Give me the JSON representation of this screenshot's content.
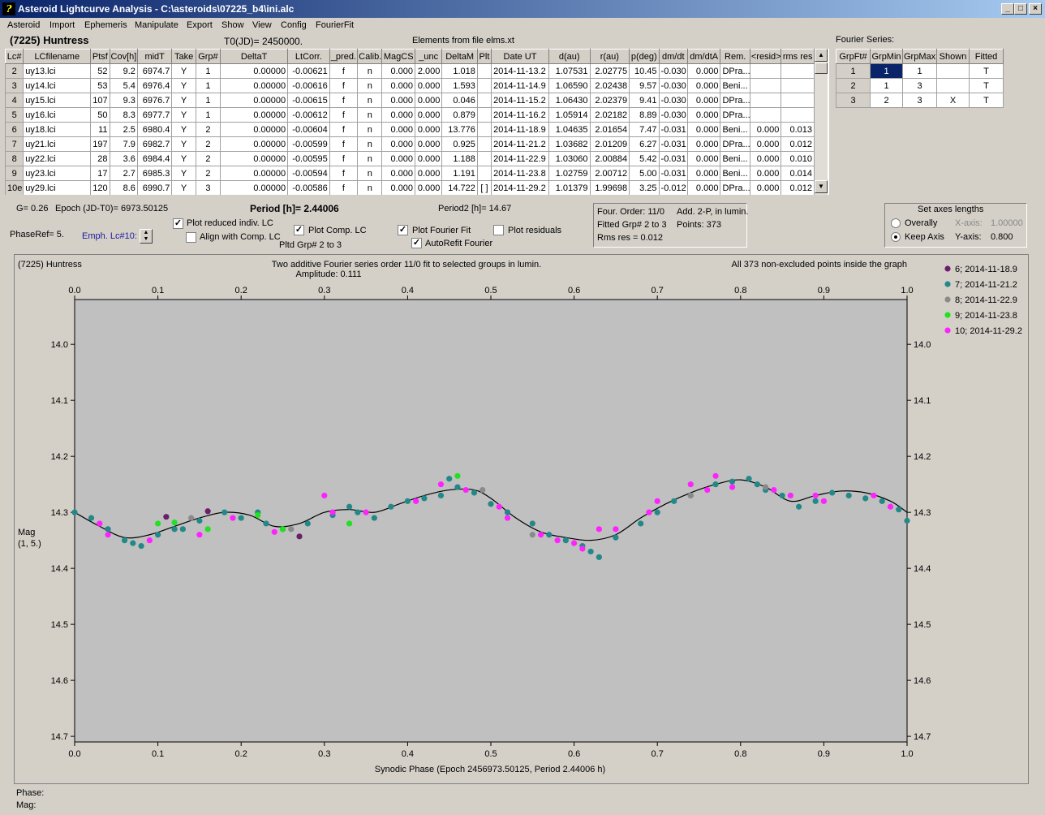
{
  "window": {
    "title": "Asteroid Lightcurve Analysis - C:\\asteroids\\07225_b4\\ini.alc",
    "min": "_",
    "max": "□",
    "close": "×"
  },
  "menu": [
    "Asteroid",
    "Import",
    "Ephemeris",
    "Manipulate",
    "Export",
    "Show",
    "View",
    "Config",
    "FourierFit"
  ],
  "header": {
    "asteroid": "(7225) Huntress",
    "t0": "T0(JD)= 2450000.",
    "elements": "Elements from file elms.xt"
  },
  "table": {
    "columns": [
      "Lc#",
      "LCfilename",
      "Ptsf",
      "Cov[h]",
      "midT",
      "Take",
      "Grp#",
      "DeltaT",
      "LtCorr.",
      "_pred.",
      "Calib.",
      "MagCS",
      "_unc",
      "DeltaM",
      "Plt",
      "Date UT",
      "d(au)",
      "r(au)",
      "p(deg)",
      "dm/dt",
      "dm/dtA",
      "Rem.",
      "<resid>",
      "rms res"
    ],
    "rows": [
      [
        "2",
        "uy13.lci",
        "52",
        "9.2",
        "6974.7",
        "Y",
        "1",
        "0.00000",
        "-0.00621",
        "f",
        "n",
        "0.000",
        "2.000",
        "1.018",
        "",
        "2014-11-13.2",
        "1.07531",
        "2.02775",
        "10.45",
        "-0.030",
        "0.000",
        "DPra...",
        "",
        ""
      ],
      [
        "3",
        "uy14.lci",
        "53",
        "5.4",
        "6976.4",
        "Y",
        "1",
        "0.00000",
        "-0.00616",
        "f",
        "n",
        "0.000",
        "0.000",
        "1.593",
        "",
        "2014-11-14.9",
        "1.06590",
        "2.02438",
        "9.57",
        "-0.030",
        "0.000",
        "Beni...",
        "",
        ""
      ],
      [
        "4",
        "uy15.lci",
        "107",
        "9.3",
        "6976.7",
        "Y",
        "1",
        "0.00000",
        "-0.00615",
        "f",
        "n",
        "0.000",
        "0.000",
        "0.046",
        "",
        "2014-11-15.2",
        "1.06430",
        "2.02379",
        "9.41",
        "-0.030",
        "0.000",
        "DPra...",
        "",
        ""
      ],
      [
        "5",
        "uy16.lci",
        "50",
        "8.3",
        "6977.7",
        "Y",
        "1",
        "0.00000",
        "-0.00612",
        "f",
        "n",
        "0.000",
        "0.000",
        "0.879",
        "",
        "2014-11-16.2",
        "1.05914",
        "2.02182",
        "8.89",
        "-0.030",
        "0.000",
        "DPra...",
        "",
        ""
      ],
      [
        "6",
        "uy18.lci",
        "11",
        "2.5",
        "6980.4",
        "Y",
        "2",
        "0.00000",
        "-0.00604",
        "f",
        "n",
        "0.000",
        "0.000",
        "13.776",
        "",
        "2014-11-18.9",
        "1.04635",
        "2.01654",
        "7.47",
        "-0.031",
        "0.000",
        "Beni...",
        "0.000",
        "0.013"
      ],
      [
        "7",
        "uy21.lci",
        "197",
        "7.9",
        "6982.7",
        "Y",
        "2",
        "0.00000",
        "-0.00599",
        "f",
        "n",
        "0.000",
        "0.000",
        "0.925",
        "",
        "2014-11-21.2",
        "1.03682",
        "2.01209",
        "6.27",
        "-0.031",
        "0.000",
        "DPra...",
        "0.000",
        "0.012"
      ],
      [
        "8",
        "uy22.lci",
        "28",
        "3.6",
        "6984.4",
        "Y",
        "2",
        "0.00000",
        "-0.00595",
        "f",
        "n",
        "0.000",
        "0.000",
        "1.188",
        "",
        "2014-11-22.9",
        "1.03060",
        "2.00884",
        "5.42",
        "-0.031",
        "0.000",
        "Beni...",
        "0.000",
        "0.010"
      ],
      [
        "9",
        "uy23.lci",
        "17",
        "2.7",
        "6985.3",
        "Y",
        "2",
        "0.00000",
        "-0.00594",
        "f",
        "n",
        "0.000",
        "0.000",
        "1.191",
        "",
        "2014-11-23.8",
        "1.02759",
        "2.00712",
        "5.00",
        "-0.031",
        "0.000",
        "Beni...",
        "0.000",
        "0.014"
      ],
      [
        "10e",
        "uy29.lci",
        "120",
        "8.6",
        "6990.7",
        "Y",
        "3",
        "0.00000",
        "-0.00586",
        "f",
        "n",
        "0.000",
        "0.000",
        "14.722",
        "[ ]",
        "2014-11-29.2",
        "1.01379",
        "1.99698",
        "3.25",
        "-0.012",
        "0.000",
        "DPra...",
        "0.000",
        "0.012"
      ]
    ]
  },
  "fourier": {
    "label": "Fourier Series:",
    "columns": [
      "GrpFt#",
      "GrpMin",
      "GrpMax",
      "Shown",
      "Fitted"
    ],
    "rows": [
      [
        "1",
        "1",
        "1",
        "",
        "T"
      ],
      [
        "2",
        "1",
        "3",
        "",
        "T"
      ],
      [
        "3",
        "2",
        "3",
        "X",
        "T"
      ]
    ]
  },
  "controls": {
    "g": "G= 0.26",
    "epoch": "Epoch (JD-T0)= 6973.50125",
    "period": "Period [h]= 2.44006",
    "period2": "Period2 [h]= 14.67",
    "phaseref": "PhaseRef= 5.",
    "emph": "Emph. Lc#10:",
    "plot_reduced": "Plot reduced indiv. LC",
    "align_comp": "Align with Comp. LC",
    "plot_comp": "Plot Comp. LC",
    "pltd_grp": "Pltd Grp#  2  to  3",
    "plot_fourier": "Plot Fourier Fit",
    "autorefit": "AutoRefit Fourier",
    "plot_residuals": "Plot residuals",
    "check": "✓"
  },
  "info": {
    "four_order": "Four. Order: 11/0",
    "add": "Add. 2-P, in lumin.",
    "fitted": "Fitted Grp# 2 to 3",
    "points": "Points: 373",
    "rms": "Rms res     = 0.012"
  },
  "axes_box": {
    "title": "Set axes lengths",
    "overally": "Overally",
    "keep": "Keep Axis",
    "xaxis_label": "X-axis:",
    "xaxis_value": "1.00000",
    "yaxis_label": "Y-axis:",
    "yaxis_value": "0.800"
  },
  "plot": {
    "title_left": "(7225) Huntress",
    "title_center": "Two additive Fourier series order 11/0 fit to selected groups in lumin.",
    "amplitude": "Amplitude: 0.111",
    "title_right": "All 373 non-excluded points inside the graph",
    "ylabel": "Mag",
    "ylabel2": "(1, 5.)"
  },
  "status": {
    "phase": "Phase:",
    "mag": "Mag:"
  },
  "chart_data": {
    "type": "scatter",
    "xlabel": "Synodic Phase (Epoch 2456973.50125, Period 2.44006 h)",
    "ylabel": "Mag",
    "xlim": [
      0.0,
      1.0
    ],
    "ylim": [
      14.71,
      13.92
    ],
    "x_ticks": [
      0.0,
      0.1,
      0.2,
      0.3,
      0.4,
      0.5,
      0.6,
      0.7,
      0.8,
      0.9,
      1.0
    ],
    "y_ticks": [
      14.0,
      14.1,
      14.2,
      14.3,
      14.4,
      14.5,
      14.6,
      14.7
    ],
    "fit_curve": {
      "x": [
        0.0,
        0.03,
        0.06,
        0.09,
        0.12,
        0.15,
        0.18,
        0.21,
        0.24,
        0.27,
        0.3,
        0.33,
        0.36,
        0.39,
        0.42,
        0.45,
        0.48,
        0.5,
        0.53,
        0.56,
        0.59,
        0.62,
        0.65,
        0.68,
        0.71,
        0.74,
        0.77,
        0.8,
        0.83,
        0.86,
        0.89,
        0.92,
        0.95,
        0.98,
        1.0
      ],
      "y": [
        14.3,
        14.325,
        14.345,
        14.34,
        14.325,
        14.31,
        14.3,
        14.305,
        14.325,
        14.32,
        14.3,
        14.295,
        14.3,
        14.285,
        14.27,
        14.26,
        14.26,
        14.275,
        14.31,
        14.335,
        14.345,
        14.35,
        14.34,
        14.31,
        14.285,
        14.265,
        14.25,
        14.242,
        14.255,
        14.28,
        14.27,
        14.262,
        14.265,
        14.28,
        14.3
      ]
    },
    "series": [
      {
        "name": "6; 2014-11-18.9",
        "color": "#6b1f6b",
        "x": [
          0.11,
          0.16,
          0.27
        ],
        "y": [
          14.308,
          14.298,
          14.343
        ]
      },
      {
        "name": "7; 2014-11-21.2",
        "color": "#228888",
        "x": [
          0.0,
          0.02,
          0.04,
          0.06,
          0.08,
          0.1,
          0.13,
          0.15,
          0.18,
          0.2,
          0.22,
          0.25,
          0.28,
          0.31,
          0.34,
          0.36,
          0.38,
          0.4,
          0.42,
          0.44,
          0.46,
          0.48,
          0.5,
          0.52,
          0.55,
          0.57,
          0.59,
          0.61,
          0.63,
          0.65,
          0.68,
          0.7,
          0.72,
          0.74,
          0.77,
          0.79,
          0.81,
          0.83,
          0.85,
          0.87,
          0.89,
          0.91,
          0.93,
          0.95,
          0.97,
          0.99,
          1.0,
          0.07,
          0.12,
          0.23,
          0.33,
          0.45,
          0.62,
          0.82
        ],
        "y": [
          14.3,
          14.31,
          14.33,
          14.35,
          14.36,
          14.34,
          14.33,
          14.315,
          14.3,
          14.31,
          14.3,
          14.33,
          14.32,
          14.305,
          14.3,
          14.31,
          14.29,
          14.28,
          14.275,
          14.27,
          14.255,
          14.265,
          14.285,
          14.3,
          14.32,
          14.34,
          14.35,
          14.36,
          14.38,
          14.345,
          14.32,
          14.3,
          14.28,
          14.27,
          14.25,
          14.245,
          14.24,
          14.26,
          14.27,
          14.29,
          14.28,
          14.265,
          14.27,
          14.275,
          14.28,
          14.295,
          14.315,
          14.355,
          14.33,
          14.32,
          14.29,
          14.24,
          14.37,
          14.25
        ]
      },
      {
        "name": "8; 2014-11-22.9",
        "color": "#8a8a8a",
        "x": [
          0.14,
          0.26,
          0.49,
          0.55,
          0.74,
          0.83
        ],
        "y": [
          14.31,
          14.33,
          14.26,
          14.34,
          14.27,
          14.255
        ]
      },
      {
        "name": "9; 2014-11-23.8",
        "color": "#22e022",
        "x": [
          0.1,
          0.12,
          0.16,
          0.25,
          0.33,
          0.46,
          0.22
        ],
        "y": [
          14.32,
          14.318,
          14.33,
          14.33,
          14.32,
          14.235,
          14.305
        ]
      },
      {
        "name": "10; 2014-11-29.2",
        "color": "#ff22ff",
        "x": [
          0.03,
          0.04,
          0.09,
          0.15,
          0.19,
          0.24,
          0.3,
          0.31,
          0.35,
          0.41,
          0.44,
          0.47,
          0.51,
          0.52,
          0.56,
          0.58,
          0.6,
          0.61,
          0.63,
          0.65,
          0.69,
          0.7,
          0.74,
          0.76,
          0.77,
          0.79,
          0.84,
          0.86,
          0.89,
          0.9,
          0.96,
          0.98
        ],
        "y": [
          14.32,
          14.34,
          14.35,
          14.34,
          14.31,
          14.335,
          14.27,
          14.3,
          14.3,
          14.28,
          14.25,
          14.26,
          14.29,
          14.31,
          14.34,
          14.35,
          14.355,
          14.365,
          14.33,
          14.33,
          14.3,
          14.28,
          14.25,
          14.26,
          14.235,
          14.255,
          14.26,
          14.27,
          14.27,
          14.28,
          14.27,
          14.29
        ]
      }
    ]
  }
}
